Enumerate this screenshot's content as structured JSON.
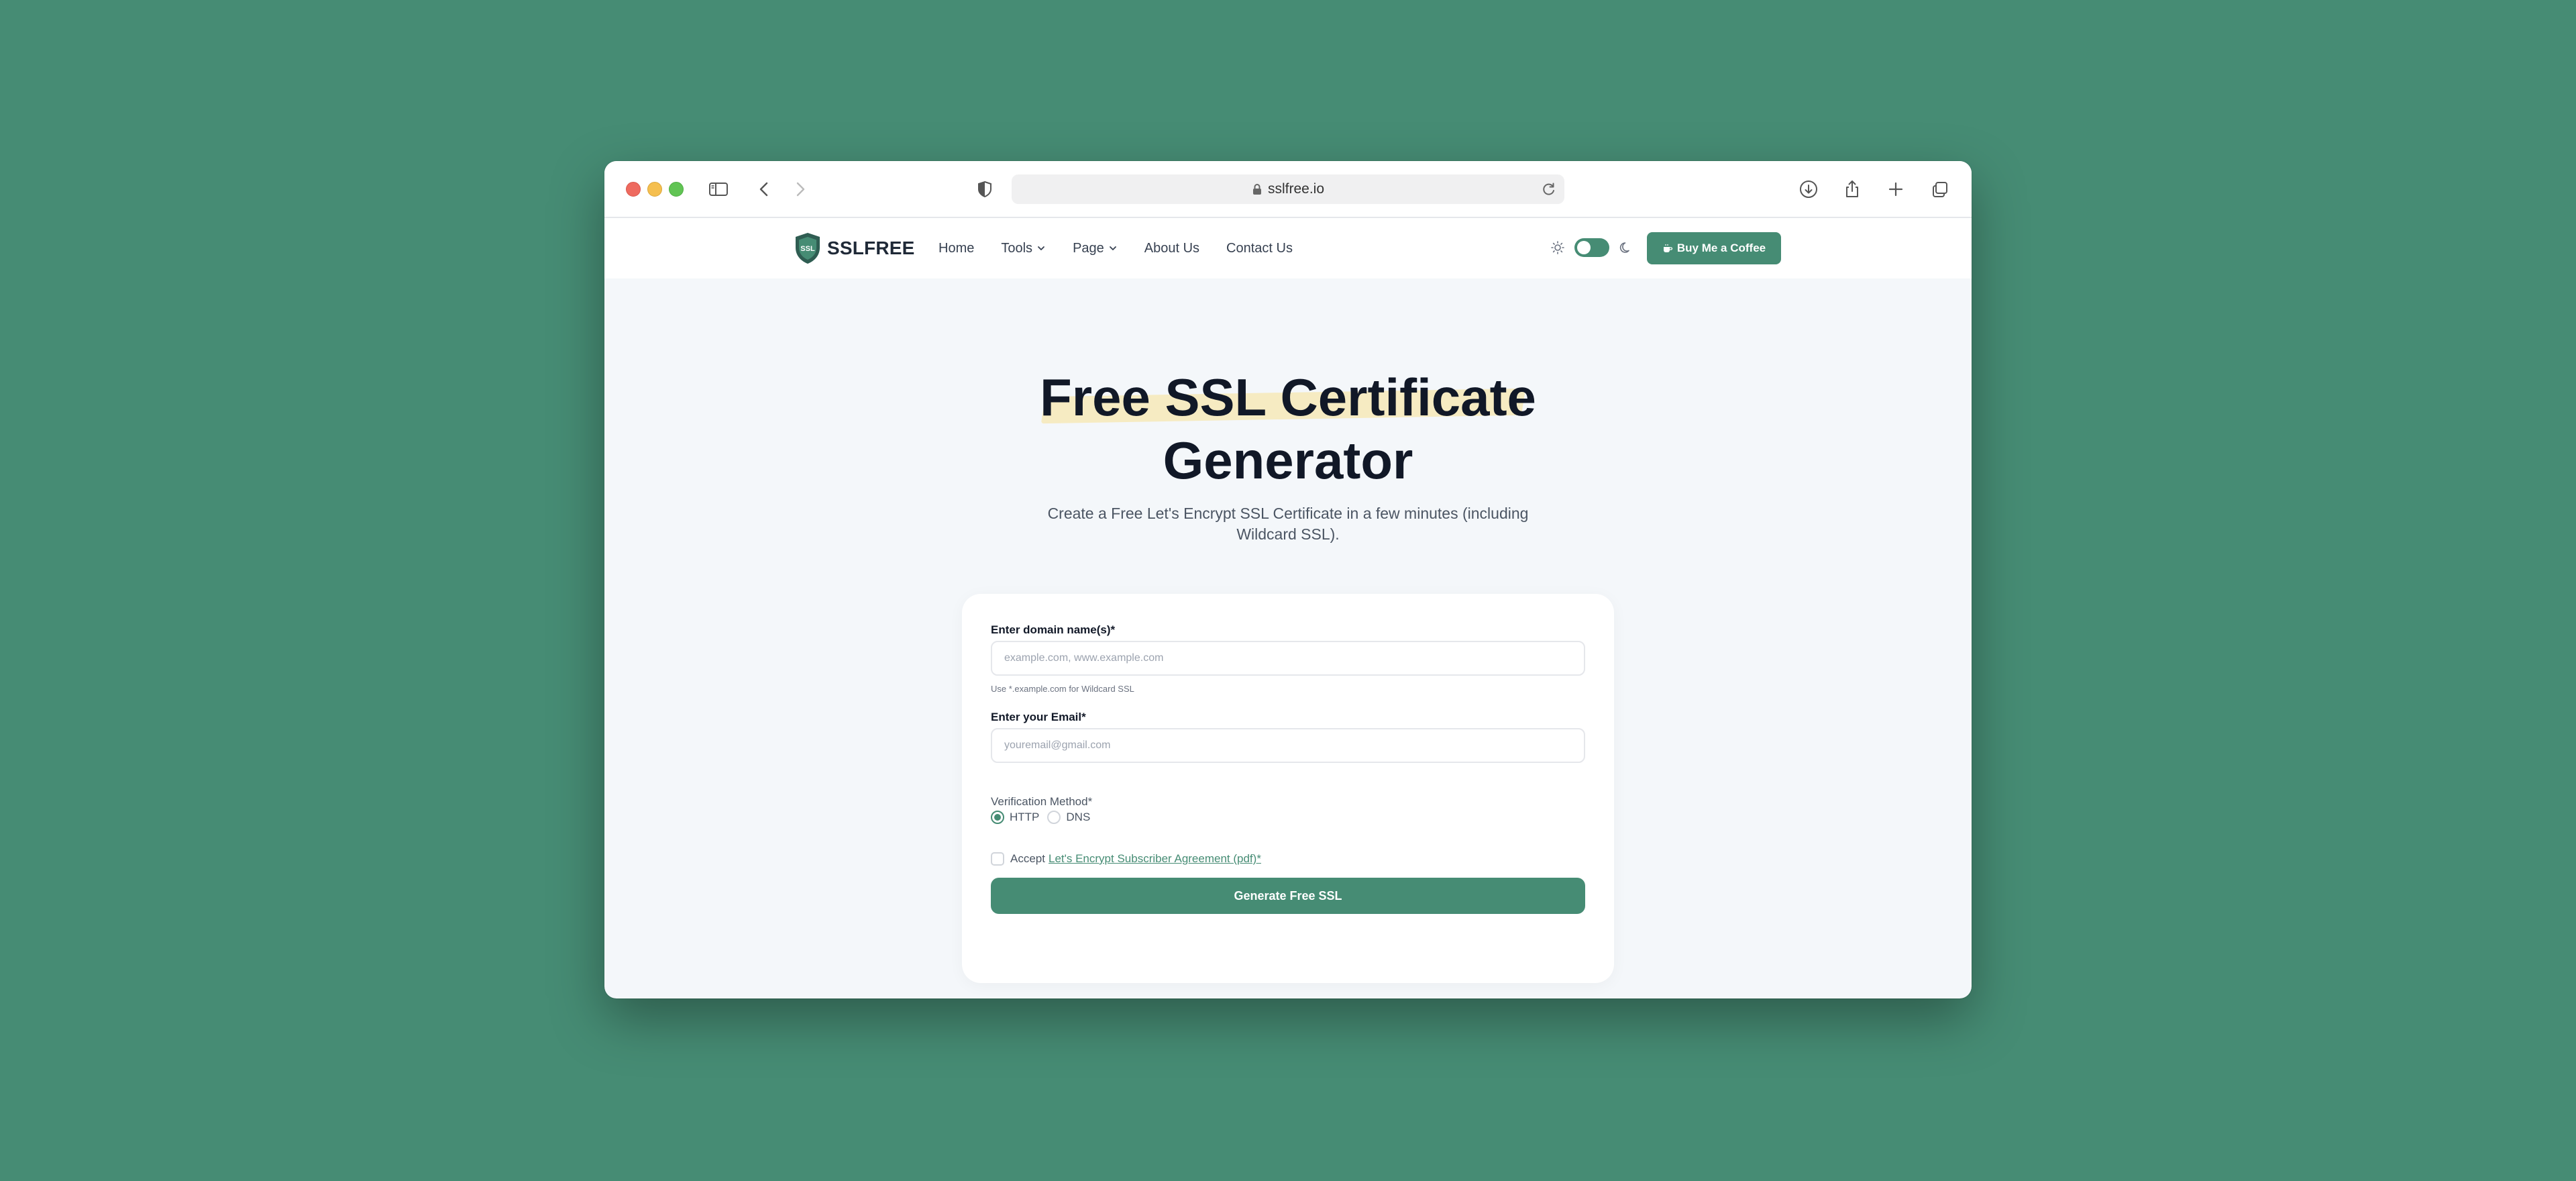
{
  "browser": {
    "url": "sslfree.io"
  },
  "site": {
    "logo_badge": "SSL",
    "brand": "SSLFREE",
    "nav": [
      {
        "label": "Home"
      },
      {
        "label": "Tools"
      },
      {
        "label": "Page"
      },
      {
        "label": "About Us"
      },
      {
        "label": "Contact Us"
      }
    ],
    "coffee_label": "Buy Me a Coffee"
  },
  "hero": {
    "title_line1": "Free SSL Certificate",
    "title_line2": "Generator",
    "subtitle": "Create a Free Let's Encrypt SSL Certificate in a few minutes (including Wildcard SSL)."
  },
  "form": {
    "domain_label": "Enter domain name(s)*",
    "domain_placeholder": "example.com, www.example.com",
    "domain_hint": "Use *.example.com for Wildcard SSL",
    "email_label": "Enter your Email*",
    "email_placeholder": "youremail@gmail.com",
    "verification_label": "Verification Method*",
    "verification_options": [
      "HTTP",
      "DNS"
    ],
    "verification_selected": "HTTP",
    "accept_label": "Accept",
    "agreement_link": "Let's Encrypt Subscriber Agreement (pdf)*",
    "accept_checked": false,
    "submit_label": "Generate Free SSL"
  },
  "colors": {
    "accent": "#468c74",
    "highlight": "#f6ebc2",
    "desktop": "#468c74"
  }
}
